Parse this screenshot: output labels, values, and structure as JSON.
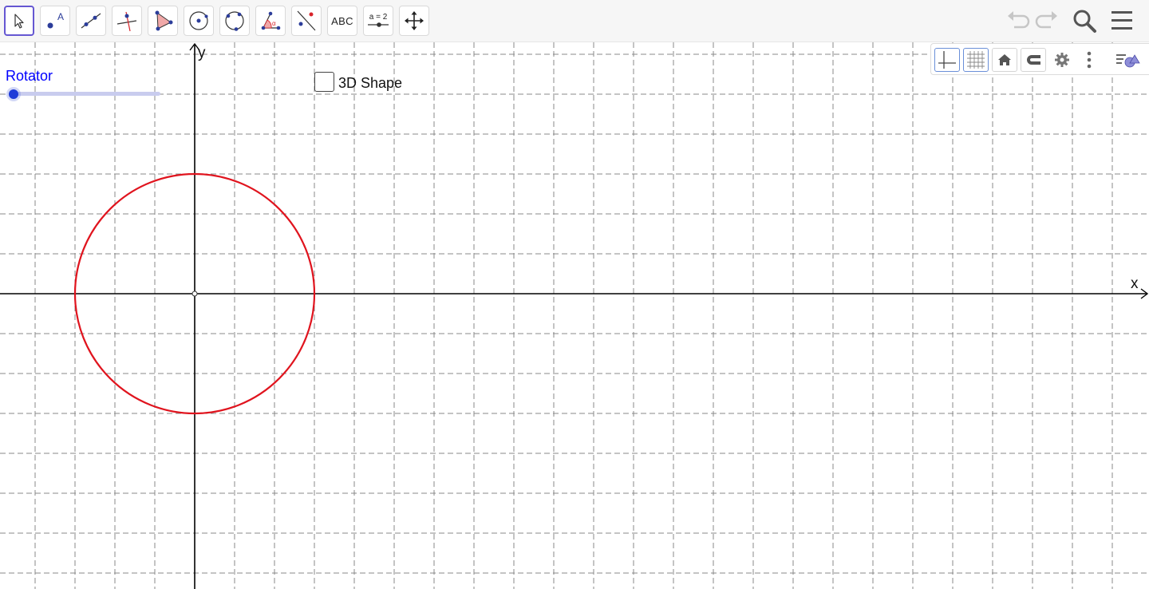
{
  "toolbar": {
    "tools": [
      {
        "name": "move-tool",
        "selected": true
      },
      {
        "name": "point-tool",
        "label": "A"
      },
      {
        "name": "line-tool"
      },
      {
        "name": "perpendicular-line-tool"
      },
      {
        "name": "polygon-tool"
      },
      {
        "name": "circle-center-point-tool"
      },
      {
        "name": "circle-three-points-tool"
      },
      {
        "name": "angle-tool",
        "label": "α"
      },
      {
        "name": "reflect-tool"
      },
      {
        "name": "text-tool",
        "label": "ABC"
      },
      {
        "name": "slider-tool",
        "label": "a = 2"
      },
      {
        "name": "move-graphics-view-tool"
      }
    ],
    "right_icons": [
      "undo-icon",
      "redo-icon",
      "search-icon",
      "menu-icon"
    ]
  },
  "stylebar": {
    "buttons": [
      "axes-icon",
      "grid-icon",
      "home-icon",
      "magnet-icon",
      "gear-icon",
      "more-vertical-icon",
      "algebra-toggle-icon"
    ]
  },
  "slider": {
    "label": "Rotator",
    "value_fraction": 0.0
  },
  "checkbox": {
    "label": "3D Shape",
    "checked": false
  },
  "axes": {
    "x_label": "x",
    "y_label": "y",
    "grid": true
  },
  "circle": {
    "center": [
      0,
      0
    ],
    "radius": 3,
    "color": "#e0141e"
  },
  "colors": {
    "accent": "#6557d2",
    "slider_label": "#0000ff",
    "grid": "#8a8a8a"
  }
}
